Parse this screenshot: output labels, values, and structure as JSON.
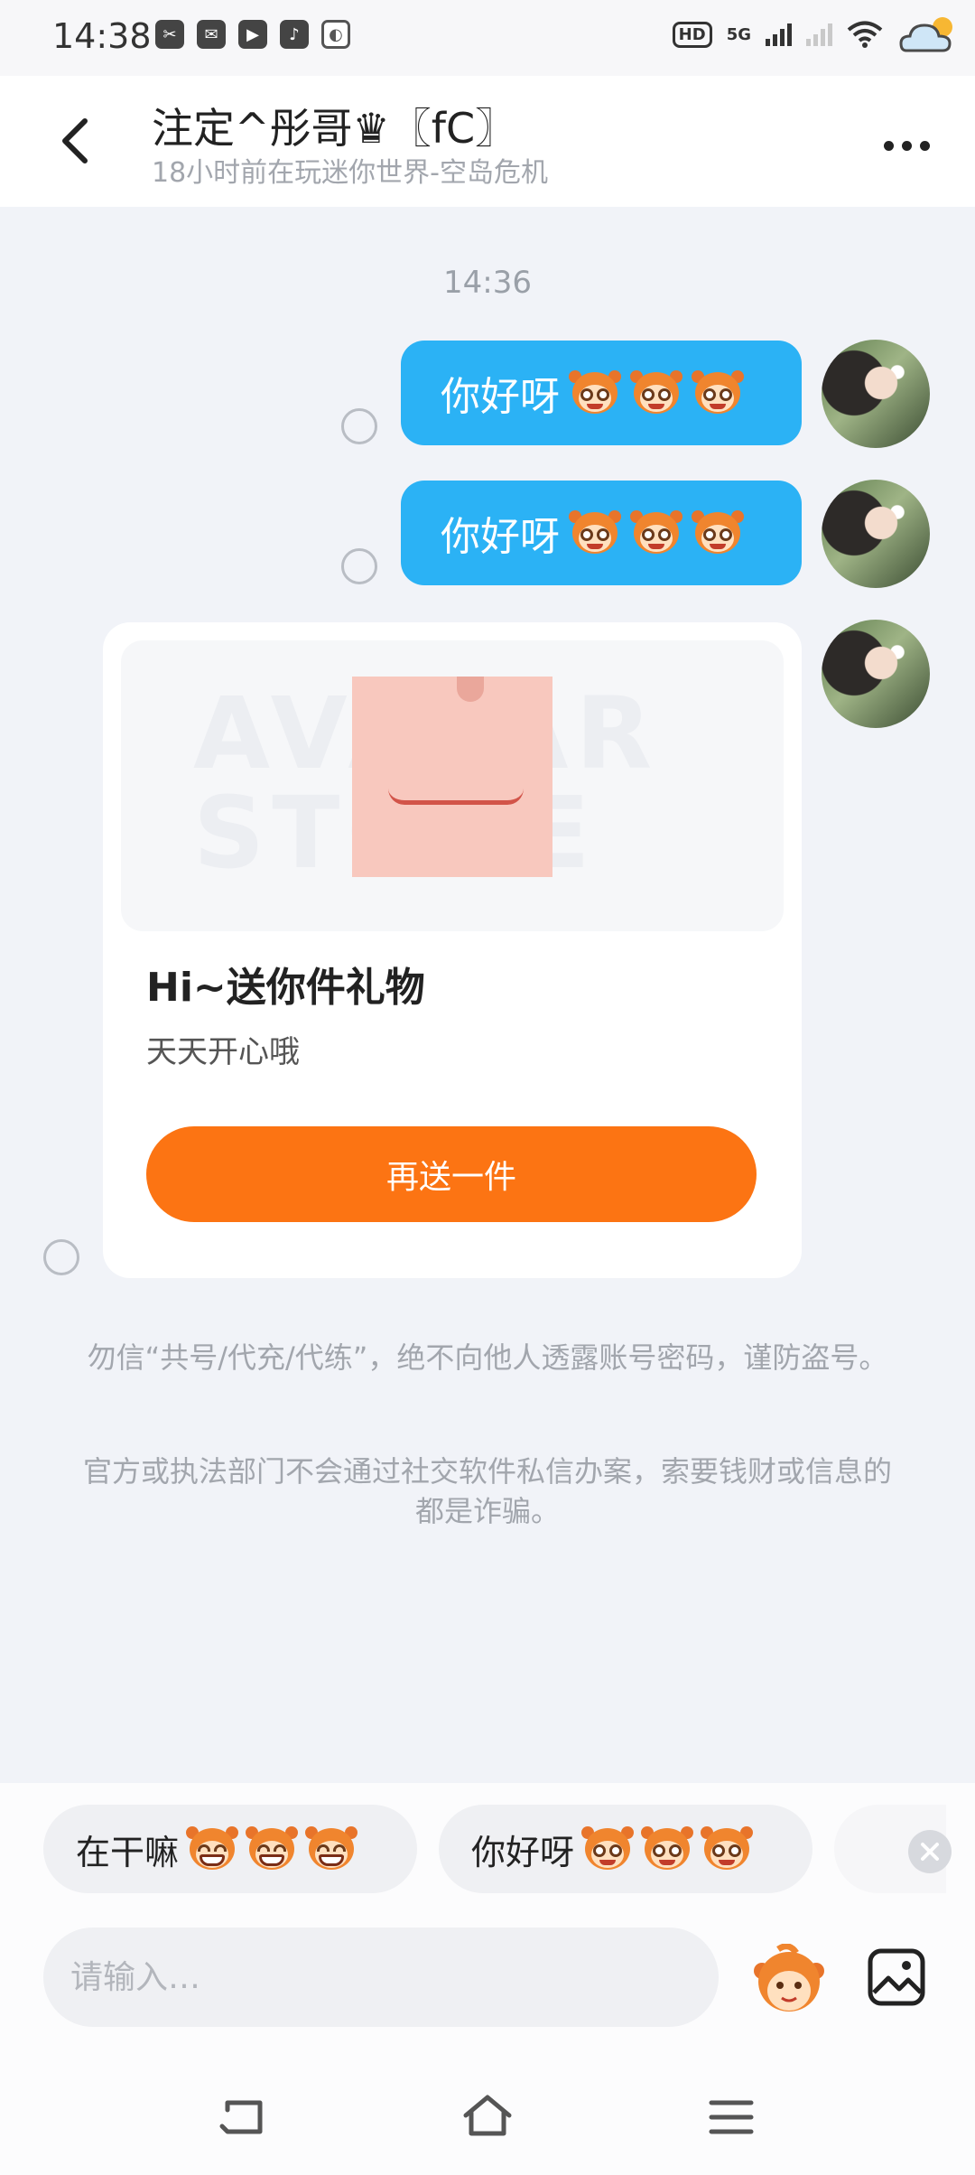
{
  "status_bar": {
    "time": "14:38",
    "hd": "HD",
    "network": "5G"
  },
  "header": {
    "title": "注定^彤哥♛〖fC〗",
    "subtitle": "18小时前在玩迷你世界-空岛危机"
  },
  "chat": {
    "timestamp": "14:36",
    "messages": [
      {
        "text": "你好呀"
      },
      {
        "text": "你好呀"
      }
    ],
    "gift": {
      "watermark": "AVATAR STORE",
      "title": "Hi~送你件礼物",
      "description": "天天开心哦",
      "button": "再送一件"
    },
    "notices": [
      "勿信“共号/代充/代练”，绝不向他人透露账号密码，谨防盗号。",
      "官方或执法部门不会通过社交软件私信办案，索要钱财或信息的都是诈骗。"
    ]
  },
  "quick_replies": [
    {
      "text": "在干嘛"
    },
    {
      "text": "你好呀"
    }
  ],
  "input": {
    "placeholder": "请输入…"
  },
  "colors": {
    "bubble": "#2bb2f5",
    "gift_button": "#fc7413",
    "background": "#f1f3f8"
  }
}
